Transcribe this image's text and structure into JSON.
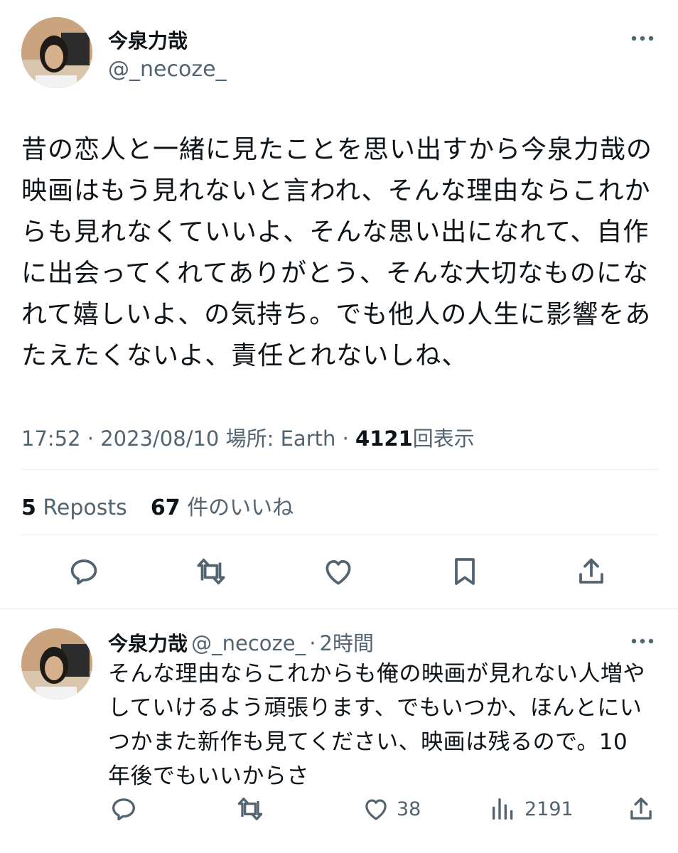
{
  "main_tweet": {
    "display_name": "今泉力哉",
    "handle": "@_necoze_",
    "lines": [
      "昔の恋人と一緒に見たことを思い出すから今泉力哉の",
      "映画はもう見れないと言われ、そんな理由ならこれか",
      "らも見れなくていいよ、そんな思い出になれて、自作",
      "に出会ってくれてありがとう、そんな大切なものにな",
      "れて嬉しいよ、の気持ち。でも他人の人生に影響をあ",
      "たえたくないよ、責任とれないしね、"
    ],
    "meta": {
      "time": "17:52",
      "date": "2023/08/10",
      "location_label": "場所: Earth",
      "views_count": "4121",
      "views_label": "回表示"
    },
    "stats": {
      "reposts_count": "5",
      "reposts_label": "Reposts",
      "likes_count": "67",
      "likes_label": "件のいいね"
    }
  },
  "reply_tweet": {
    "display_name": "今泉力哉",
    "handle": "@_necoze_",
    "time_ago": "2時間",
    "lines": [
      "そんな理由ならこれからも俺の映画が見れない人増や",
      "していけるよう頑張ります、でもいつか、ほんとにい",
      "つかまた新作も見てください、映画は残るので。10",
      "年後でもいいからさ"
    ],
    "likes_count": "38",
    "views_count": "2191"
  },
  "icons": [
    "reply-icon",
    "repost-icon",
    "like-icon",
    "bookmark-icon",
    "share-icon",
    "views-icon",
    "more-icon"
  ],
  "colors": {
    "text": "#0f1419",
    "secondary": "#536471",
    "divider": "#e8ecef"
  }
}
